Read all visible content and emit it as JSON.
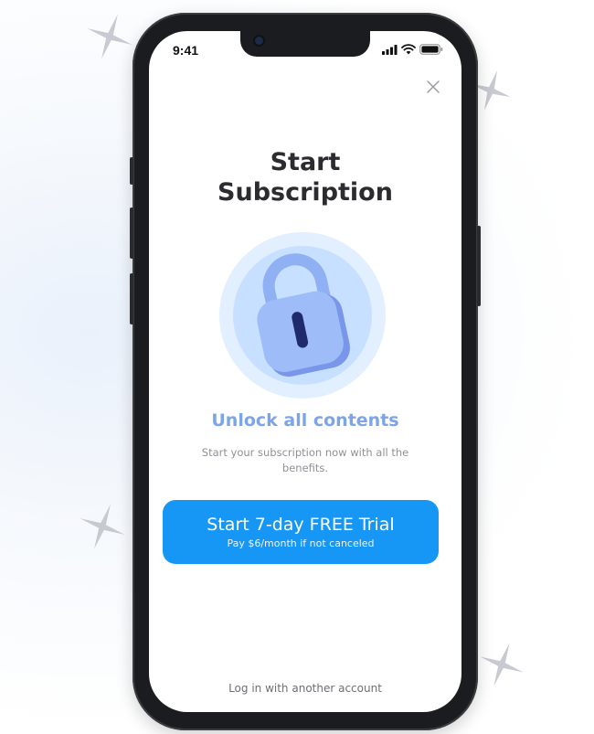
{
  "status_bar": {
    "time": "9:41"
  },
  "modal": {
    "title_line1": "Start",
    "title_line2": "Subscription",
    "headline": "Unlock all contents",
    "description": "Start your subscription now with all the benefits.",
    "cta_label": "Start 7-day FREE Trial",
    "cta_sublabel": "Pay $6/month if not canceled",
    "login_link": "Log in with another account",
    "close_icon": "close-icon",
    "hero_icon": "padlock-icon"
  },
  "colors": {
    "accent": "#1797f5",
    "headline": "#7ba5e8",
    "title": "#2b2b30",
    "phone_frame": "#1b1c1f"
  }
}
